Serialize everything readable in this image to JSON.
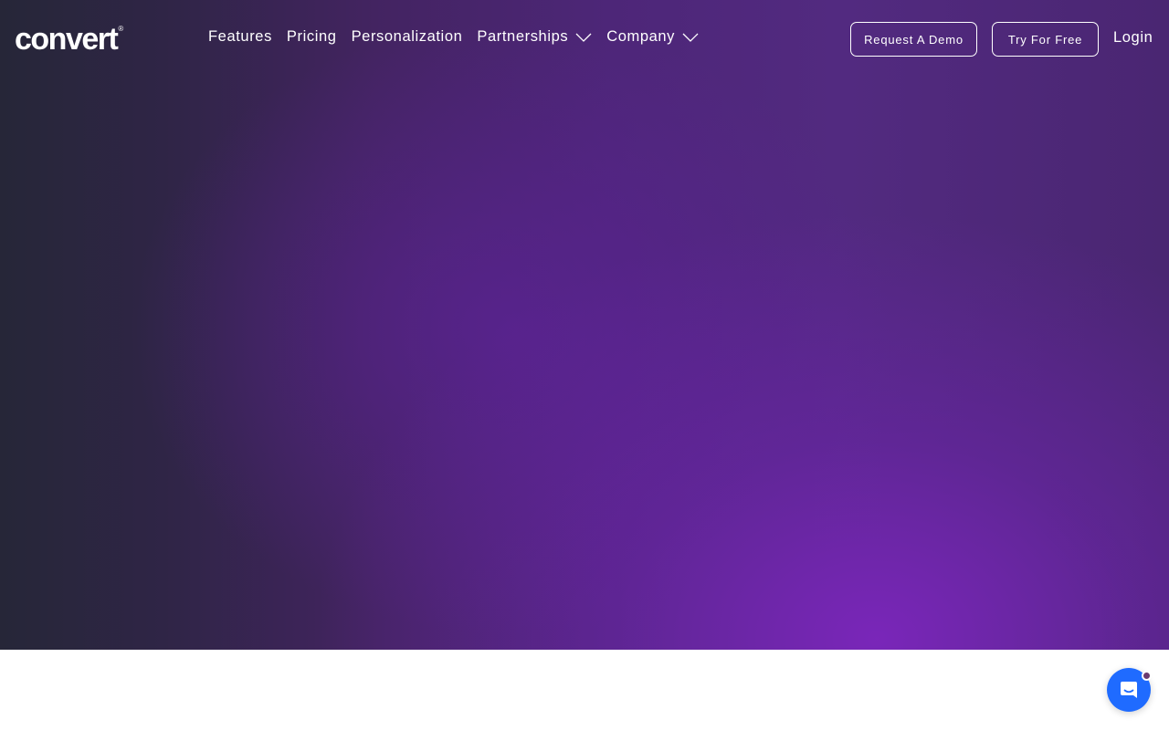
{
  "brand": {
    "logo_text": "convert",
    "logo_reg": "®"
  },
  "nav": {
    "items": [
      {
        "label": "Features",
        "has_dropdown": false
      },
      {
        "label": "Pricing",
        "has_dropdown": false
      },
      {
        "label": "Personalization",
        "has_dropdown": false
      },
      {
        "label": "Partnerships",
        "has_dropdown": true
      },
      {
        "label": "Company",
        "has_dropdown": true
      }
    ],
    "request_demo_label": "Request A Demo",
    "try_free_label": "Try For Free",
    "login_label": "Login"
  },
  "chat_widget": {
    "icon": "chat-bubble-icon",
    "has_notification": true
  },
  "colors": {
    "hero_dark": "#262638",
    "hero_purple": "#7d26be",
    "chat_blue": "#1f6bff",
    "text": "#ffffff"
  }
}
